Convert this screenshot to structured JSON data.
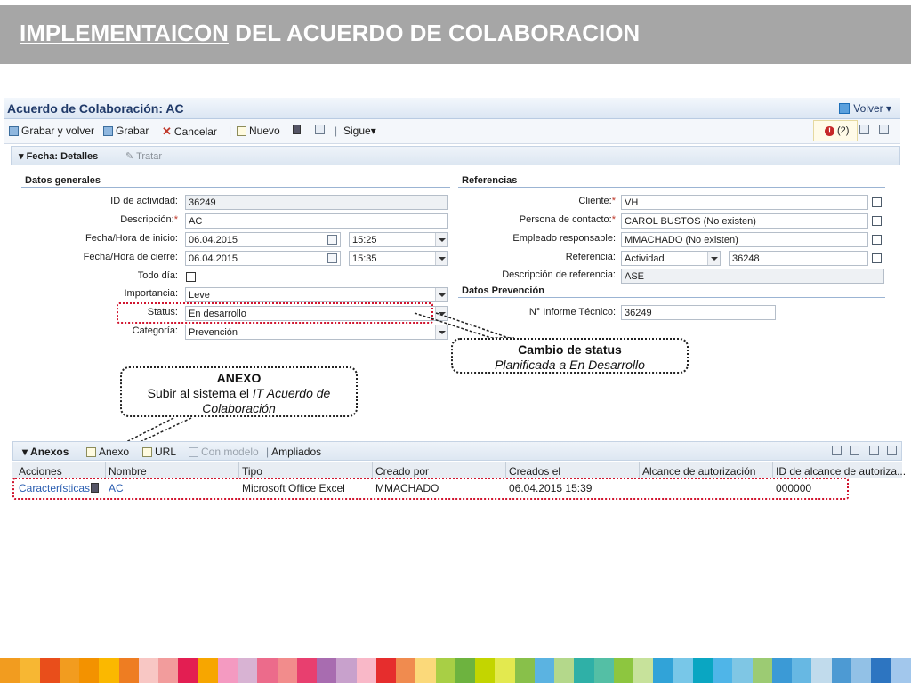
{
  "slide": {
    "title_underlined": "IMPLEMENTAICON",
    "title_rest": " DEL ACUERDO DE COLABORACION"
  },
  "window": {
    "title": "Acuerdo de Colaboración: AC",
    "back_label": "Volver ▾"
  },
  "toolbar": {
    "save_back": "Grabar y volver",
    "save": "Grabar",
    "cancel": "Cancelar",
    "new": "Nuevo",
    "separator": "|",
    "follow": "Sigue▾",
    "messages": "(2)"
  },
  "panel": {
    "title": "Fecha: Detalles",
    "tab2": "Tratar"
  },
  "datos_generales": {
    "heading": "Datos generales",
    "fields": [
      {
        "label": "ID de actividad:",
        "value": "36249",
        "required": ""
      },
      {
        "label": "Descripción:",
        "value": "AC",
        "required": "*"
      },
      {
        "label": "Fecha/Hora de inicio:",
        "value": "06.04.2015",
        "value2": "15:25",
        "required": ""
      },
      {
        "label": "Fecha/Hora de cierre:",
        "value": "06.04.2015",
        "value2": "15:35",
        "required": ""
      },
      {
        "label": "Todo día:",
        "value": "",
        "required": ""
      },
      {
        "label": "Importancia:",
        "value": "Leve",
        "required": ""
      },
      {
        "label": "Status:",
        "value": "En desarrollo",
        "required": ""
      },
      {
        "label": "Categoría:",
        "value": "Prevención",
        "required": ""
      }
    ]
  },
  "referencias": {
    "heading": "Referencias",
    "fields": [
      {
        "label": "Cliente:",
        "value": "VH",
        "required": "*"
      },
      {
        "label": "Persona de contacto:",
        "value": "CAROL BUSTOS (No existen)",
        "required": "*"
      },
      {
        "label": "Empleado responsable:",
        "value": "MMACHADO (No existen)",
        "required": ""
      },
      {
        "label": "Referencia:",
        "value": "Actividad",
        "value2": "36248",
        "required": ""
      },
      {
        "label": "Descripción de referencia:",
        "value": "ASE",
        "required": ""
      }
    ]
  },
  "datos_prevencion": {
    "heading": "Datos Prevención",
    "fields": [
      {
        "label": "N° Informe Técnico:",
        "value": "36249"
      }
    ]
  },
  "callouts": {
    "status": {
      "title": "Cambio de status",
      "text": "Planificada a En Desarrollo"
    },
    "anexo": {
      "title": "ANEXO",
      "text_prefix": "Subir al sistema el ",
      "text_italic": "IT Acuerdo de Colaboración"
    }
  },
  "anexos": {
    "title": "Anexos",
    "toolbar": [
      "Anexo",
      "URL",
      "Con modelo",
      "Ampliados"
    ],
    "columns": [
      "Acciones",
      "Nombre",
      "Tipo",
      "Creado por",
      "Creados el",
      "Alcance de autorización",
      "ID de alcance de autoriza..."
    ],
    "rows": [
      [
        "Características",
        "AC",
        "Microsoft Office Excel",
        "MMACHADO",
        "06.04.2015 15:39",
        "",
        "000000"
      ]
    ]
  },
  "colors": {
    "header_bg": "#a6a6a6",
    "highlight": "#d0142e",
    "strip": [
      "#f29c1f",
      "#f7b733",
      "#e94e1b",
      "#f29c1f",
      "#f39200",
      "#fbb800",
      "#ee7d22",
      "#f8c7c4",
      "#f29c9c",
      "#e31e52",
      "#f7a600",
      "#f49ac1",
      "#d8b3d3",
      "#ec6b8b",
      "#f28c8c",
      "#e83f6f",
      "#a86cb0",
      "#c8a1cc",
      "#f9b8c8",
      "#e62d2d",
      "#f08b4f",
      "#fbd97a",
      "#a8cf45",
      "#6db33f",
      "#c3d500",
      "#e3e94f",
      "#88c04a",
      "#5bb3e1",
      "#b4d88b",
      "#2fb0a7",
      "#54bfa5",
      "#8dc63f",
      "#c7e29b",
      "#31a3d8",
      "#78c7e8",
      "#0aa6c2",
      "#4fb5e8",
      "#7fc6e4",
      "#9ccb73",
      "#3b9ad6",
      "#67b8e3",
      "#c1dbec",
      "#4d9ad3",
      "#92c1e6",
      "#2d75c1",
      "#a2c7ec"
    ]
  }
}
